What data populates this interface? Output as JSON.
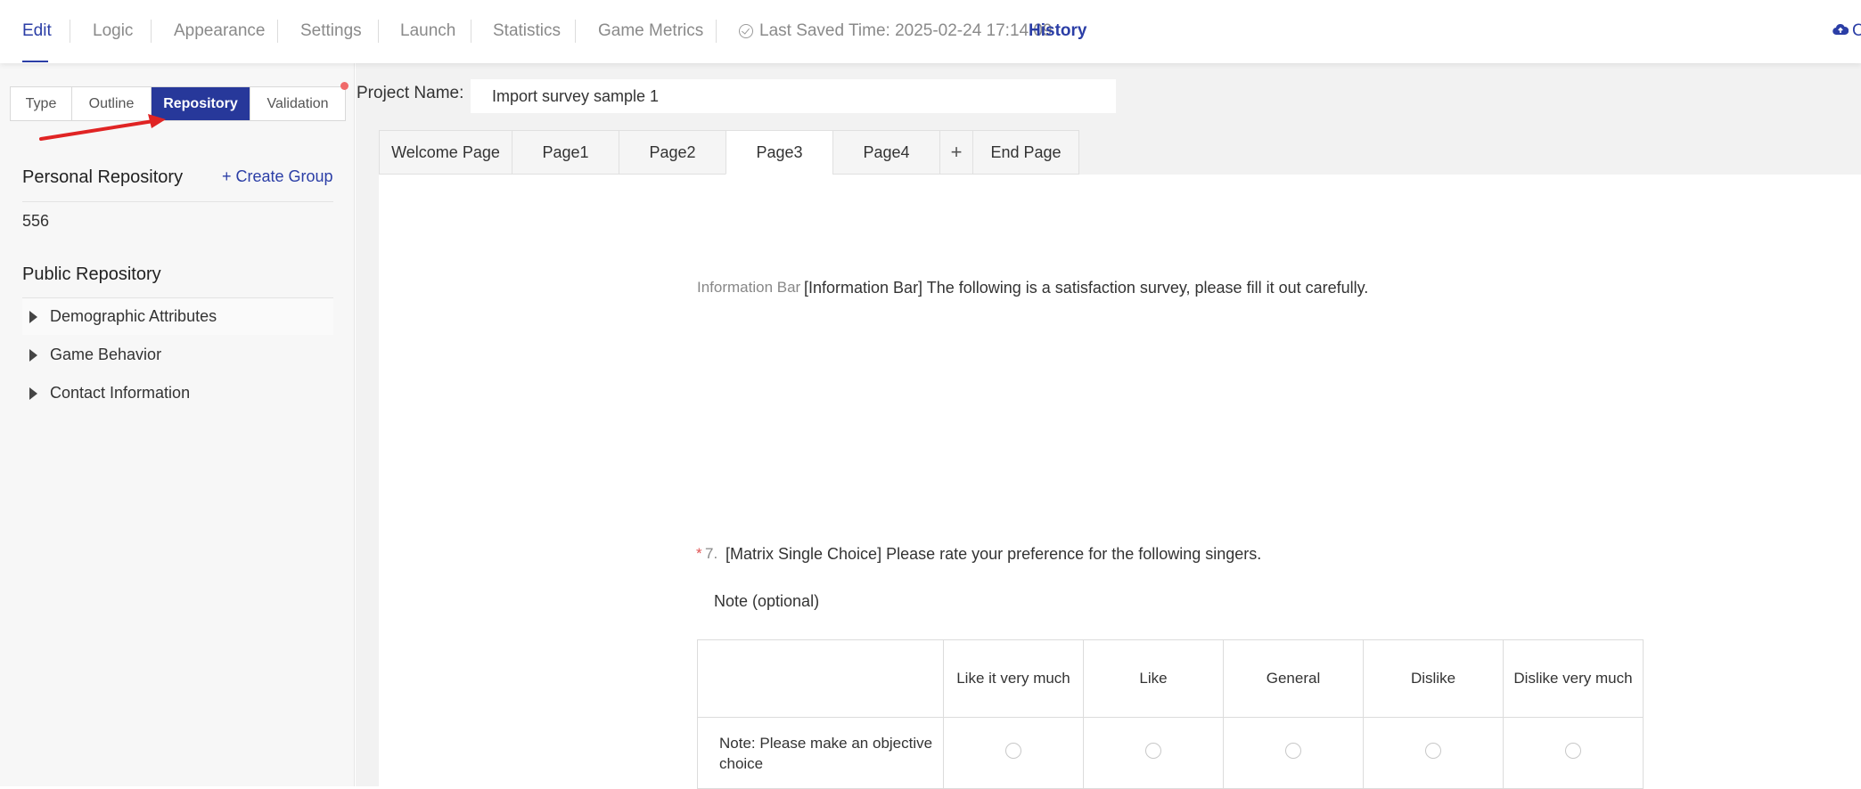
{
  "nav": {
    "items": [
      "Edit",
      "Logic",
      "Appearance",
      "Settings",
      "Launch",
      "Statistics",
      "Game Metrics"
    ],
    "active": "Edit",
    "saved_time": "Last Saved Time: 2025-02-24 17:14:09",
    "history": "History",
    "cloud_icon": "cloud-upload-icon",
    "cloud_label": "C",
    "accent_color": "#2b3ea6"
  },
  "sidebar": {
    "tabs": [
      "Type",
      "Outline",
      "Repository",
      "Validation"
    ],
    "active_tab": "Repository",
    "personal_repository": {
      "title": "Personal Repository",
      "create_group": "+ Create Group",
      "groups": [
        "556"
      ]
    },
    "public_repository": {
      "title": "Public Repository",
      "items": [
        "Demographic Attributes",
        "Game Behavior",
        "Contact Information"
      ]
    }
  },
  "main": {
    "project_name_label": "Project Name:",
    "project_name_value": "Import survey sample 1",
    "page_tabs": [
      "Welcome Page",
      "Page1",
      "Page2",
      "Page3",
      "Page4",
      "+",
      "End Page"
    ],
    "active_page": "Page3",
    "info_bar": {
      "label": "Information Bar",
      "text": "[Information Bar] The following is a satisfaction survey, please fill it out carefully."
    },
    "question": {
      "required_mark": "*",
      "number": "7.",
      "text": "[Matrix Single Choice] Please rate your preference for the following singers.",
      "note": "Note (optional)",
      "columns": [
        "Like it very much",
        "Like",
        "General",
        "Dislike",
        "Dislike very much"
      ],
      "rows": [
        "Note: Please make an objective choice"
      ]
    }
  }
}
